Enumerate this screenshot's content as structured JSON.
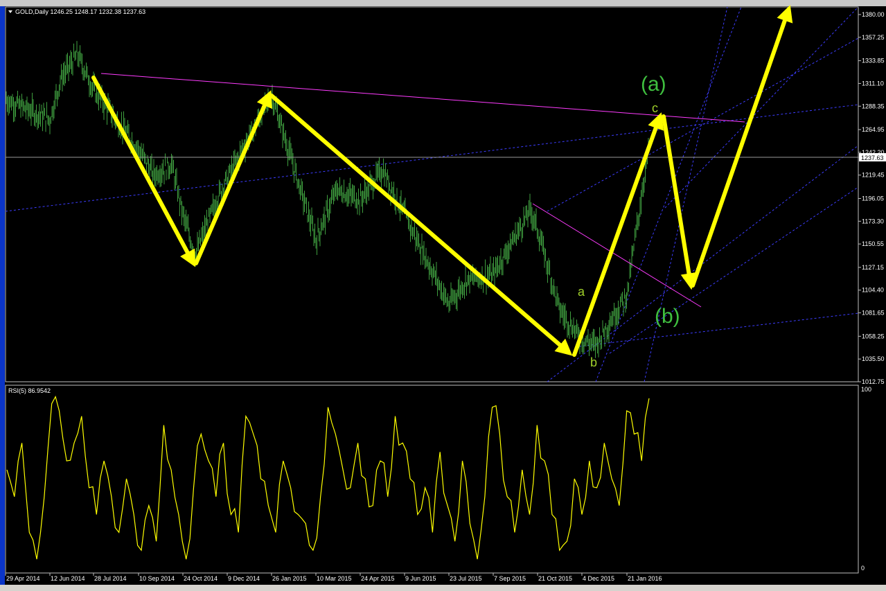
{
  "window": {
    "symbol_header": "GOLD,Daily  1246.25 1248.17 1232.38 1237.63",
    "rsi_header": "RSI(5) 86.9542"
  },
  "price_axis": {
    "ticks": [
      "1380.00",
      "1357.25",
      "1333.85",
      "1311.10",
      "1288.35",
      "1264.95",
      "1242.20",
      "1219.45",
      "1196.05",
      "1173.30",
      "1150.55",
      "1127.15",
      "1104.40",
      "1081.65",
      "1058.25",
      "1035.50",
      "1012.75"
    ],
    "current": "1237.63"
  },
  "rsi_axis": {
    "ticks": [
      "100",
      "0"
    ]
  },
  "date_axis": {
    "ticks": [
      "29 Apr 2014",
      "12 Jun 2014",
      "28 Jul 2014",
      "10 Sep 2014",
      "24 Oct 2014",
      "9 Dec 2014",
      "26 Jan 2015",
      "10 Mar 2015",
      "24 Apr 2015",
      "9 Jun 2015",
      "23 Jul 2015",
      "7 Sep 2015",
      "21 Oct 2015",
      "4 Dec 2015",
      "21 Jan 2016"
    ]
  },
  "annotations": {
    "wave_a_big": "(a)",
    "wave_b_big": "(b)",
    "wave_a_small": "a",
    "wave_b_small": "b",
    "wave_c_small": "c"
  },
  "colors": {
    "price": "#3f9f3f",
    "rsi": "#ffff00",
    "arrow": "#ffff00",
    "trendline": "#ff3cff",
    "channel": "#3c3cff",
    "wave_label": "#3fbf3f",
    "small_label": "#a0d02a"
  },
  "chart_data": [
    {
      "type": "candlestick",
      "title": "GOLD,Daily",
      "x_label": "",
      "y_label": "",
      "ylim": [
        1012.75,
        1380.0
      ],
      "close_path": [
        [
          "29 Apr 2014",
          1295
        ],
        [
          "12 Jun 2014",
          1275
        ],
        [
          "20 Jun 2014",
          1316
        ],
        [
          "10 Jul 2014",
          1340
        ],
        [
          "28 Jul 2014",
          1305
        ],
        [
          "10 Sep 2014",
          1245
        ],
        [
          "24 Sep 2014",
          1220
        ],
        [
          "10 Oct 2014",
          1230
        ],
        [
          "24 Oct 2014",
          1180
        ],
        [
          "6 Nov 2014",
          1140
        ],
        [
          "1 Dec 2014",
          1200
        ],
        [
          "26 Jan 2015",
          1300
        ],
        [
          "10 Mar 2015",
          1155
        ],
        [
          "30 Mar 2015",
          1205
        ],
        [
          "24 Apr 2015",
          1195
        ],
        [
          "15 May 2015",
          1225
        ],
        [
          "9 Jun 2015",
          1180
        ],
        [
          "23 Jul 2015",
          1090
        ],
        [
          "10 Aug 2015",
          1115
        ],
        [
          "7 Sep 2015",
          1120
        ],
        [
          "15 Oct 2015",
          1185
        ],
        [
          "21 Oct 2015",
          1165
        ],
        [
          "10 Nov 2015",
          1085
        ],
        [
          "4 Dec 2015",
          1055
        ],
        [
          "17 Dec 2015",
          1050
        ],
        [
          "21 Jan 2016",
          1100
        ],
        [
          "11 Feb 2016",
          1245
        ]
      ],
      "last": {
        "open": 1246.25,
        "high": 1248.17,
        "low": 1232.38,
        "close": 1237.63
      }
    },
    {
      "type": "line",
      "title": "RSI(5)",
      "x_label": "",
      "y_label": "",
      "ylim": [
        0,
        100
      ],
      "series": [
        {
          "values": [
            55,
            40,
            70,
            20,
            5,
            40,
            92,
            88,
            60,
            70,
            85,
            45,
            30,
            60,
            40,
            20,
            50,
            30,
            10,
            35,
            15,
            80,
            55,
            30,
            5,
            45,
            75,
            60,
            40,
            70,
            30,
            20,
            85,
            75,
            50,
            35,
            20,
            60,
            45,
            30,
            25,
            10,
            40,
            90,
            75,
            55,
            45,
            70,
            50,
            35,
            60,
            40,
            85,
            70,
            50,
            30,
            45,
            20,
            65,
            35,
            15,
            60,
            25,
            5,
            40,
            90,
            75,
            40,
            20,
            55,
            30,
            80,
            60,
            30,
            10,
            15,
            50,
            30,
            60,
            45,
            70,
            50,
            35,
            88,
            75,
            60,
            95
          ]
        }
      ],
      "last_value": 86.9542
    }
  ]
}
